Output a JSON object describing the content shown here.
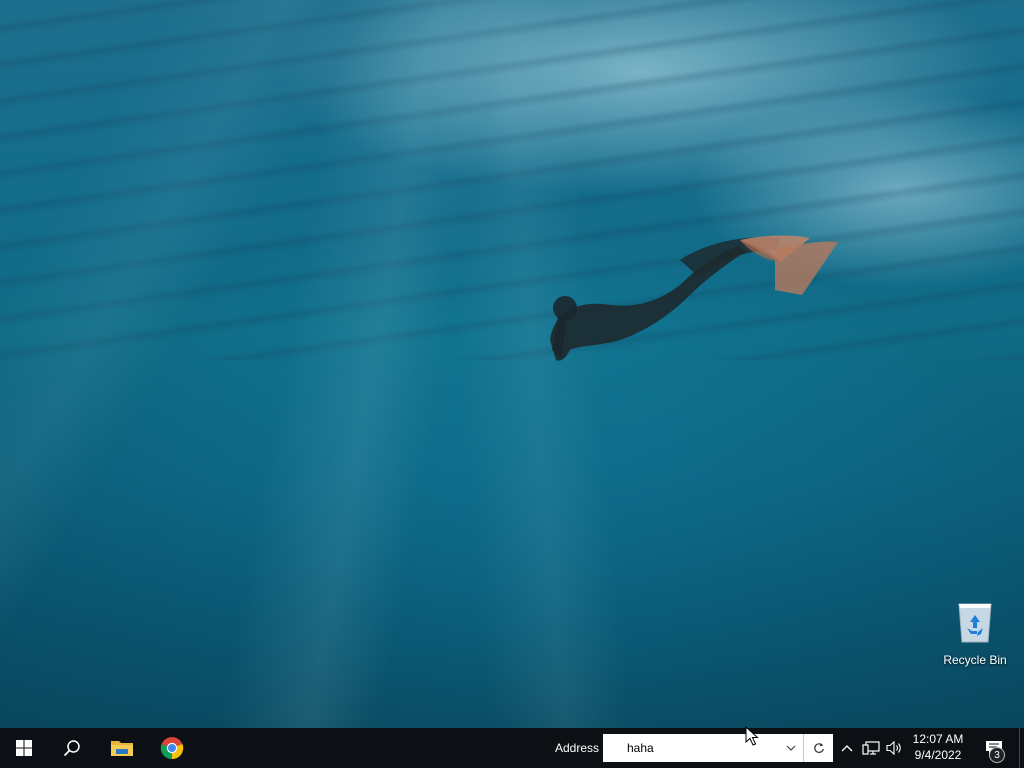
{
  "desktop": {
    "wallpaper": "underwater-freediver",
    "icons": [
      {
        "label": "Recycle Bin",
        "icon": "recycle-bin-icon"
      }
    ]
  },
  "taskbar": {
    "background": "#0c1014",
    "pinned": [
      {
        "name": "Start",
        "icon": "windows-logo-icon"
      },
      {
        "name": "Search",
        "icon": "search-icon"
      },
      {
        "name": "File Explorer",
        "icon": "folder-icon"
      },
      {
        "name": "Google Chrome",
        "icon": "chrome-icon"
      }
    ],
    "address_toolbar": {
      "label": "Address",
      "value": "haha"
    },
    "tray": {
      "icons": [
        "chevron-up-icon",
        "network-icon",
        "volume-icon"
      ],
      "time": "12:07 AM",
      "date": "9/4/2022",
      "notification_count": "3"
    }
  }
}
